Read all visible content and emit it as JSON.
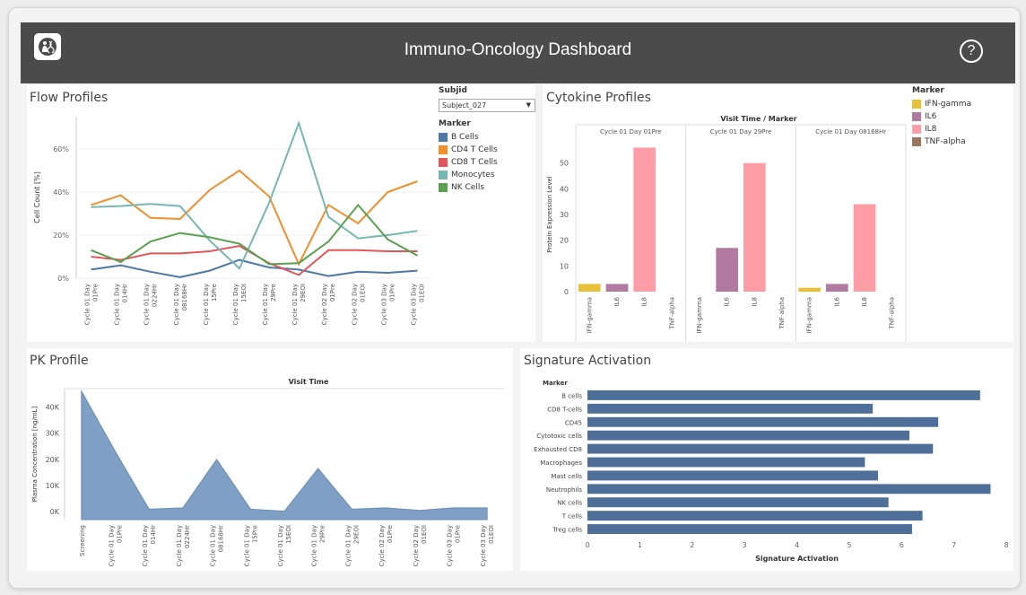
{
  "header": {
    "title": "Immuno-Oncology Dashboard",
    "help_label": "?",
    "logo_icon": "dna-person-icon",
    "help_icon": "question-circle-icon"
  },
  "flow": {
    "title": "Flow Profiles",
    "filter_label": "Subjid",
    "filter_value": "Subject_027",
    "legend_title": "Marker"
  },
  "cytokine": {
    "title": "Cytokine Profiles",
    "header": "Visit Time / Marker",
    "legend_title": "Marker"
  },
  "pk": {
    "title": "PK Profile"
  },
  "signature": {
    "title": "Signature Activation"
  },
  "chart_data": [
    {
      "id": "flow",
      "type": "line",
      "ylabel": "Cell Count [%]",
      "ylim": [
        0,
        75
      ],
      "yticks": [
        0,
        20,
        40,
        60
      ],
      "ytick_labels": [
        "0%",
        "20%",
        "40%",
        "60%"
      ],
      "grid": true,
      "legend_placement": "right",
      "x": [
        "Cycle 01 Day 01Pre",
        "Cycle 01 Day 014Hr",
        "Cycle 01 Day 0224Hr",
        "Cycle 01 Day 08168Hr",
        "Cycle 01 Day 15Pre",
        "Cycle 01 Day 15EOI",
        "Cycle 01 Day 29Pre",
        "Cycle 01 Day 29EOI",
        "Cycle 02 Day 01Pre",
        "Cycle 02 Day 01EOI",
        "Cycle 03 Day 01Pre",
        "Cycle 03 Day 01EOI"
      ],
      "series": [
        {
          "name": "B Cells",
          "color": "#4e79a7",
          "values": [
            4,
            6,
            3,
            0.5,
            3.5,
            8.5,
            5,
            4,
            1,
            3,
            2.5,
            3.5
          ]
        },
        {
          "name": "CD4 T Cells",
          "color": "#f28e2b",
          "values": [
            34,
            38.5,
            28,
            27.5,
            41,
            50,
            38,
            6.5,
            34,
            25.5,
            40,
            45
          ]
        },
        {
          "name": "CD8 T Cells",
          "color": "#e15759",
          "values": [
            10,
            8.5,
            11.5,
            11.5,
            12.5,
            15,
            7,
            1.5,
            13,
            13,
            12.5,
            12.5
          ]
        },
        {
          "name": "Monocytes",
          "color": "#76b7b2",
          "values": [
            33,
            33.5,
            34.5,
            33.5,
            17.5,
            4.5,
            35,
            72,
            28.5,
            18.5,
            20,
            22
          ]
        },
        {
          "name": "NK Cells",
          "color": "#59a14f",
          "values": [
            13,
            7.5,
            17,
            21,
            19,
            16,
            6.5,
            7,
            17,
            34,
            18,
            10.5
          ]
        }
      ]
    },
    {
      "id": "cytokine",
      "type": "bar",
      "ylabel": "Protein Expression Level",
      "ylim": [
        0,
        60
      ],
      "yticks": [
        0,
        10,
        20,
        30,
        40,
        50
      ],
      "panels": [
        "Cycle 01 Day 01Pre",
        "Cycle 01 Day 29Pre",
        "Cycle 01 Day 08168Hr"
      ],
      "categories": [
        "IFN-gamma",
        "IL6",
        "IL8",
        "TNF-alpha"
      ],
      "colors": {
        "IFN-gamma": "#e8c038",
        "IL6": "#b07aa1",
        "IL8": "#ff9da7",
        "TNF-alpha": "#9c755f"
      },
      "values": [
        [
          3,
          3,
          56,
          0
        ],
        [
          0,
          17,
          50,
          0
        ],
        [
          1.5,
          3,
          34,
          0
        ]
      ],
      "legend_placement": "right"
    },
    {
      "id": "pk",
      "type": "area",
      "title": "Visit Time",
      "ylabel": "Plasma Concentration [ng/mL]",
      "ylim": [
        -3000,
        47000
      ],
      "yticks": [
        0,
        10000,
        20000,
        30000,
        40000
      ],
      "ytick_labels": [
        "0K",
        "10K",
        "20K",
        "30K",
        "40K"
      ],
      "color": "#7f9fc4",
      "x": [
        "Screening",
        "Cycle 01 Day 01Pre",
        "Cycle 01 Day 014Hr",
        "Cycle 01 Day 0224Hr",
        "Cycle 01 Day 08168Hr",
        "Cycle 01 Day 15Pre",
        "Cycle 01 Day 15EOI",
        "Cycle 01 Day 29Pre",
        "Cycle 01 Day 29EOI",
        "Cycle 02 Day 01Pre",
        "Cycle 02 Day 01EOI",
        "Cycle 03 Day 01Pre",
        "Cycle 03 Day 01EOI"
      ],
      "values": [
        46000,
        23000,
        1000,
        1500,
        20000,
        1000,
        200,
        16500,
        1000,
        1500,
        500,
        1500,
        1500
      ]
    },
    {
      "id": "signature",
      "type": "bar",
      "orientation": "horizontal",
      "ylabel": "Marker",
      "xlabel": "Signature Activation",
      "xlim": [
        0,
        8
      ],
      "xticks": [
        0,
        1,
        2,
        3,
        4,
        5,
        6,
        7,
        8
      ],
      "color": "#4e6f9a",
      "categories": [
        "B cells",
        "CD8 T-cells",
        "CD45",
        "Cytotoxic cells",
        "Exhausted CD8",
        "Macrophages",
        "Mast cells",
        "Neutrophils",
        "NK cells",
        "T cells",
        "Treg cells"
      ],
      "values": [
        7.5,
        5.45,
        6.7,
        6.15,
        6.6,
        5.3,
        5.55,
        7.7,
        5.75,
        6.4,
        6.2
      ]
    }
  ]
}
